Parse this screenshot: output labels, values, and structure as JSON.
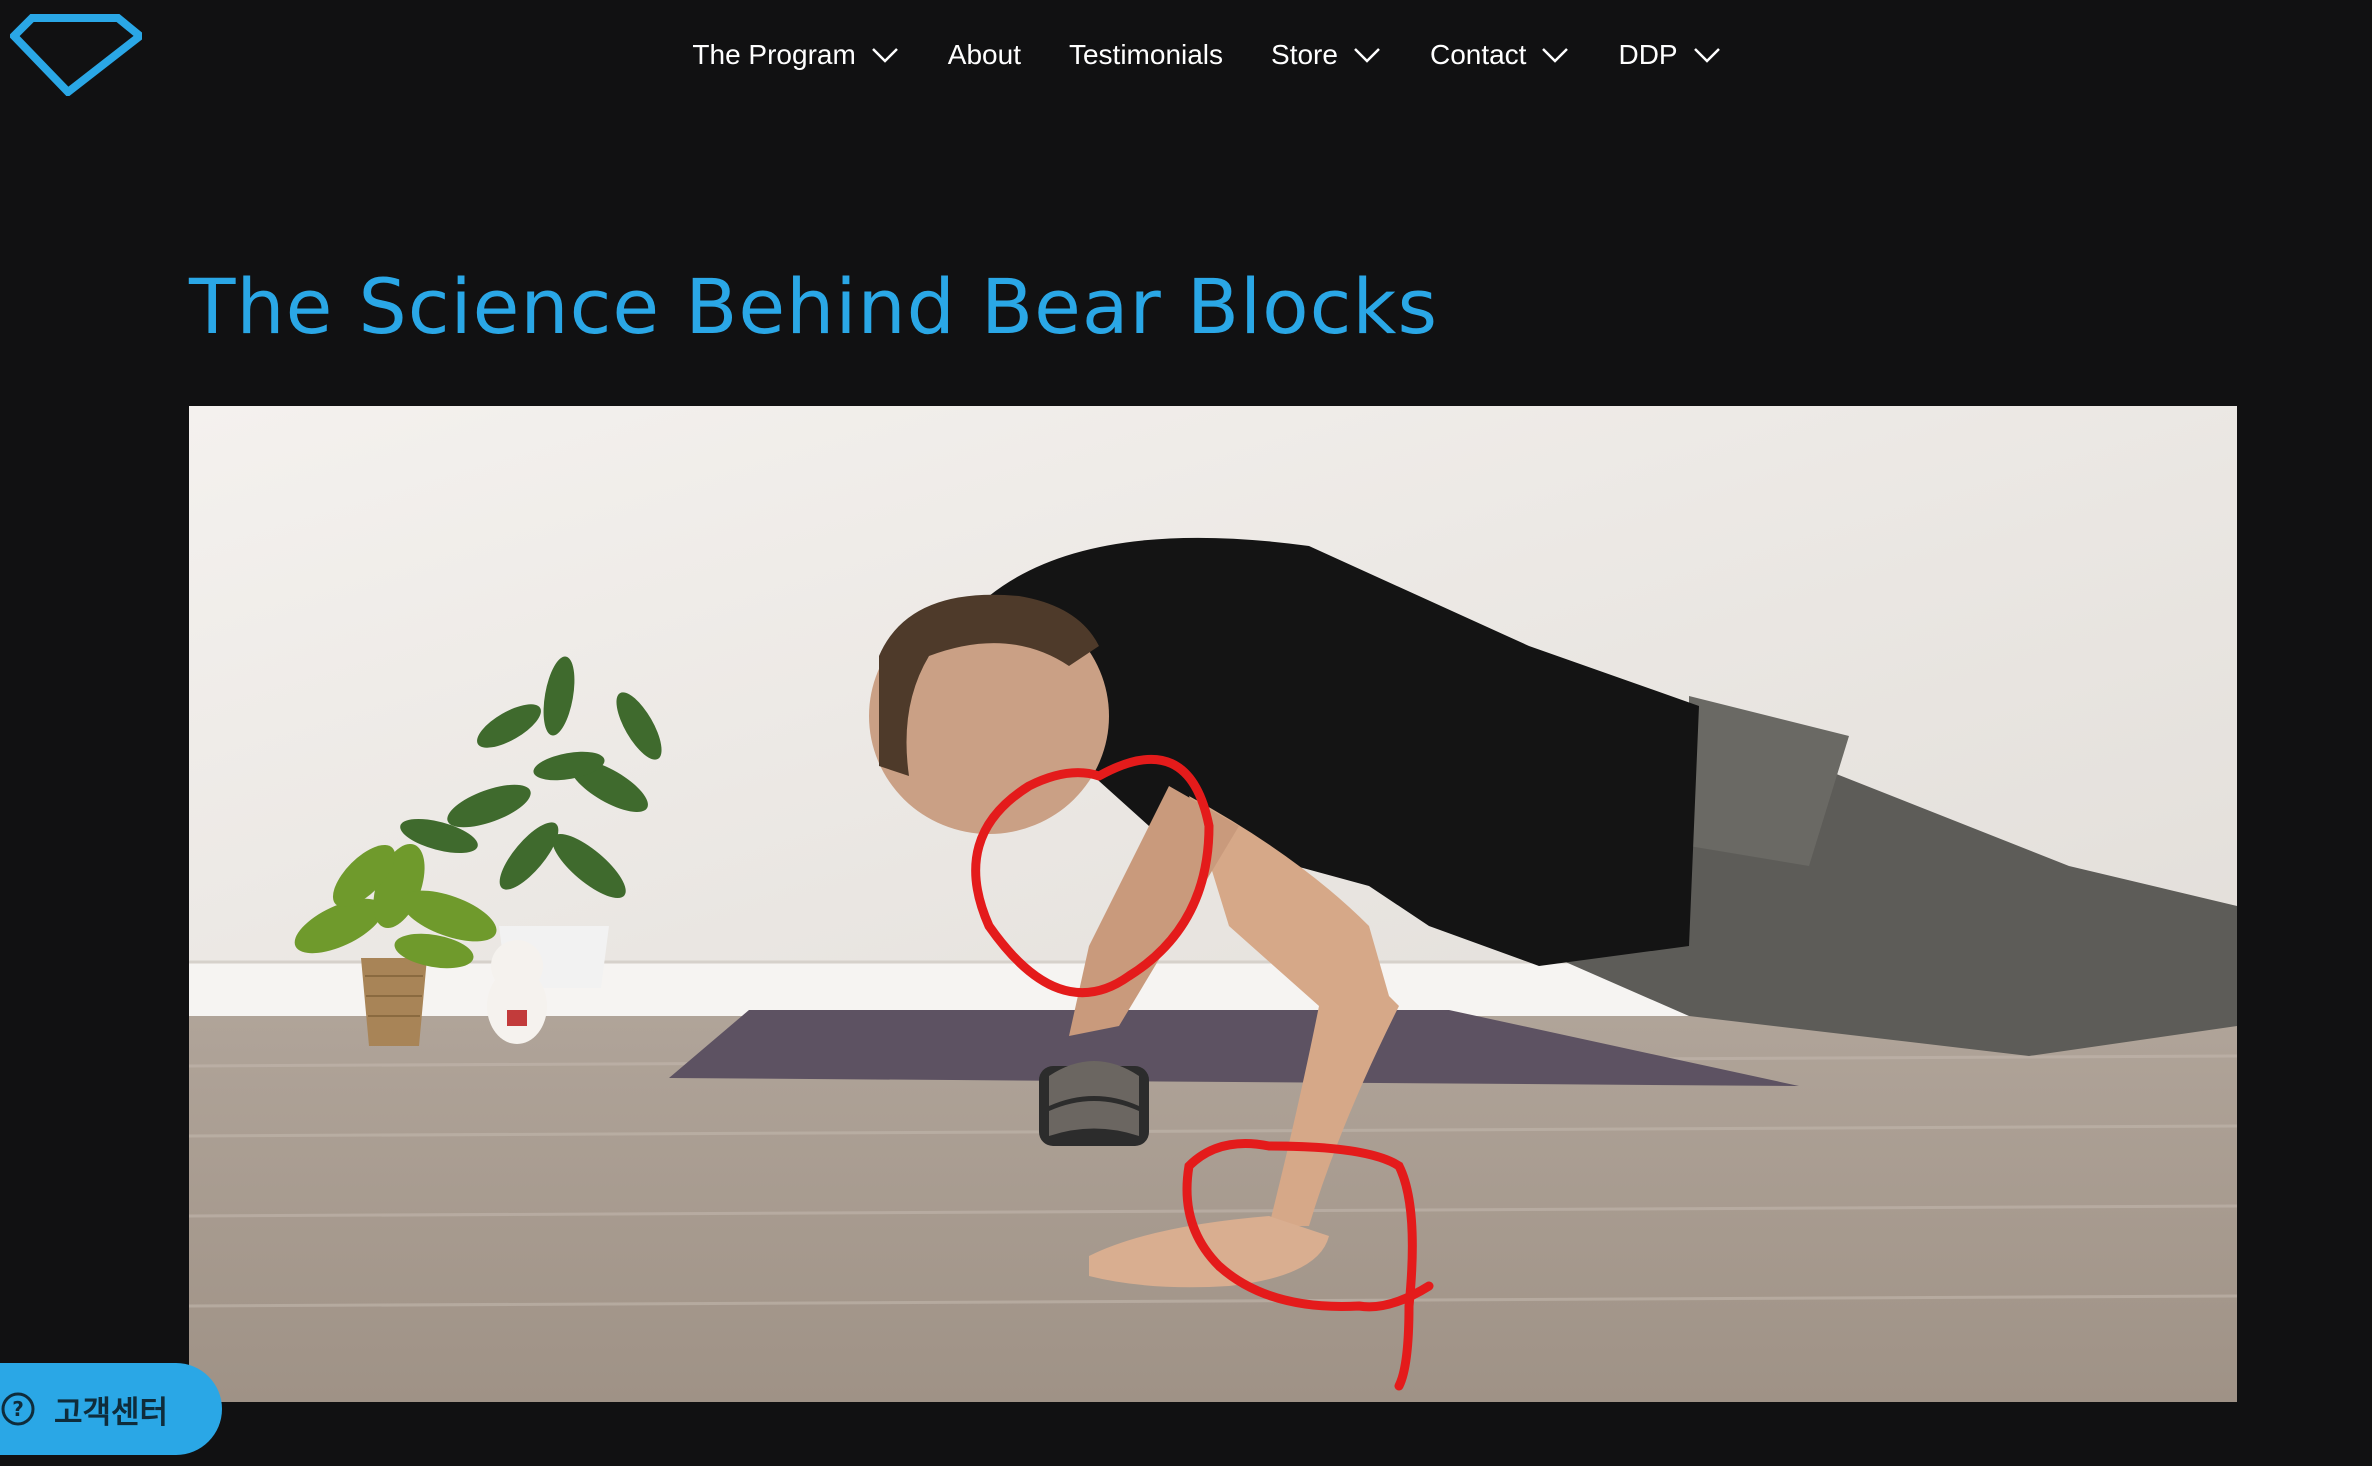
{
  "site": {
    "logo_icon": "diamond-logo-icon",
    "accent_color": "#2aa7e6",
    "background_color": "#111112"
  },
  "nav": {
    "items": [
      {
        "label": "The Program",
        "has_dropdown": true
      },
      {
        "label": "About",
        "has_dropdown": false
      },
      {
        "label": "Testimonials",
        "has_dropdown": false
      },
      {
        "label": "Store",
        "has_dropdown": true
      },
      {
        "label": "Contact",
        "has_dropdown": true
      },
      {
        "label": "DDP",
        "has_dropdown": true
      }
    ]
  },
  "article": {
    "title": "The Science Behind Bear Blocks",
    "hero_image": "man doing push-up with one hand on a bear block, red circles around hand and wrist"
  },
  "help_widget": {
    "label": "고객센터",
    "icon": "question-circle-icon"
  }
}
